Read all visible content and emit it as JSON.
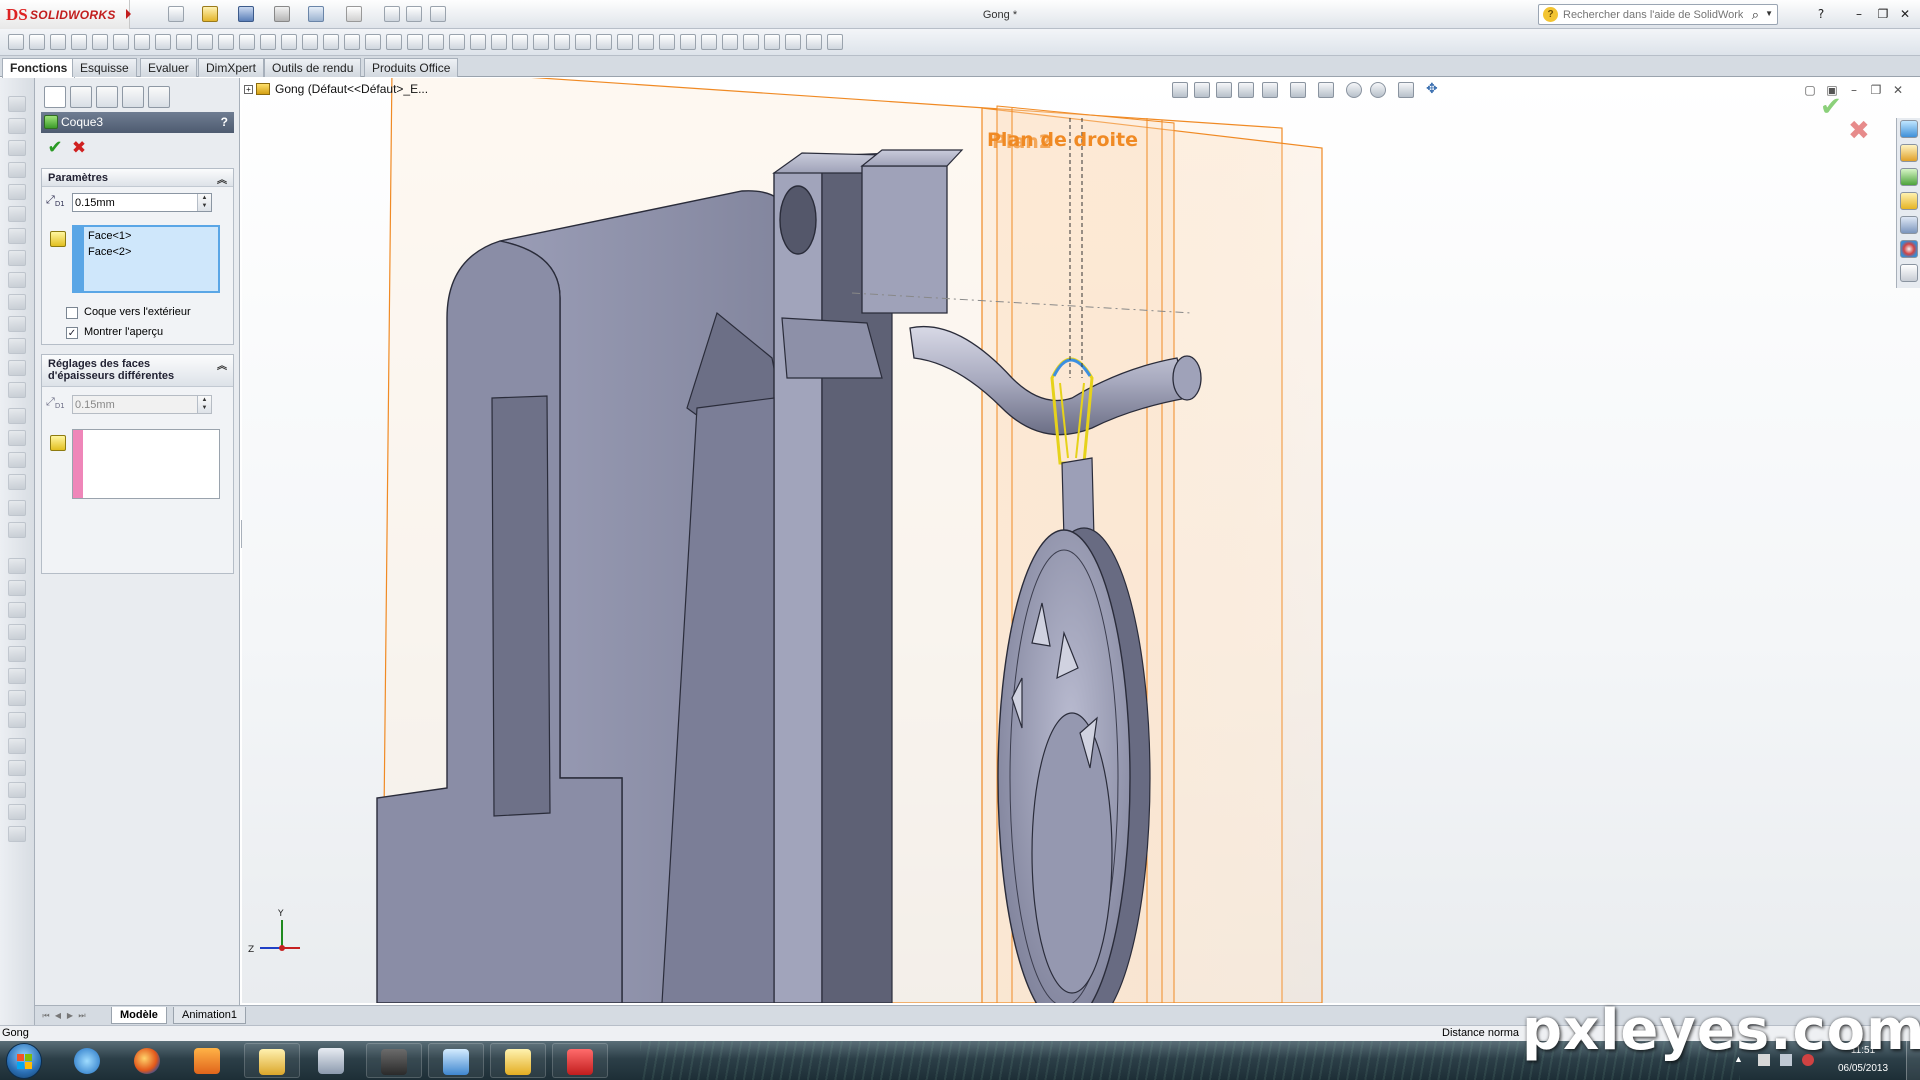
{
  "app": {
    "brand": "SOLIDWORKS",
    "brand_mark": "DS",
    "document_title": "Gong *",
    "help_search_placeholder": "Rechercher dans l'aide de SolidWorks"
  },
  "window_controls": {
    "minimize": "–",
    "restore": "❐",
    "close": "✕",
    "help": "?"
  },
  "command_tabs": [
    {
      "label": "Fonctions",
      "active": true
    },
    {
      "label": "Esquisse",
      "active": false
    },
    {
      "label": "Evaluer",
      "active": false
    },
    {
      "label": "DimXpert",
      "active": false
    },
    {
      "label": "Outils de rendu",
      "active": false
    },
    {
      "label": "Produits Office",
      "active": false
    }
  ],
  "property_manager": {
    "feature_name": "Coque3",
    "help": "?",
    "ok": "✔",
    "cancel": "✖",
    "parameters": {
      "title": "Paramètres",
      "thickness": "0.15mm",
      "faces": [
        "Face<1>",
        "Face<2>"
      ],
      "outward_label": "Coque vers l'extérieur",
      "outward_checked": false,
      "preview_label": "Montrer l'aperçu",
      "preview_checked": true
    },
    "multi_thickness": {
      "title_line1": "Réglages des faces",
      "title_line2": "d'épaisseurs différentes",
      "thickness": "0.15mm",
      "faces": []
    }
  },
  "feature_tree": {
    "expander": "+",
    "root_label": "Gong  (Défaut<<Défaut>_E..."
  },
  "viewport": {
    "plane_label": "Plan de droite",
    "plane_label_overlap": "Plan2",
    "triad": {
      "y": "Y",
      "z": "Z"
    },
    "confirm_ok": "✔",
    "confirm_cancel": "✖"
  },
  "bottom_tabs": [
    {
      "label": "Modèle",
      "active": true
    },
    {
      "label": "Animation1",
      "active": false
    }
  ],
  "status_bar": {
    "left": "Gong",
    "right": "Distance norma"
  },
  "taskbar": {
    "time": "11:51",
    "date": "06/05/2013"
  },
  "watermark": "pxleyes.com",
  "colors": {
    "model_face": "#8b8fa8",
    "model_dark": "#5a5d72",
    "plane_orange": "#f08a24",
    "selection_yellow": "#e6d21a",
    "selection_blue": "#3d8fe0",
    "pm_header": "#5b687d"
  }
}
